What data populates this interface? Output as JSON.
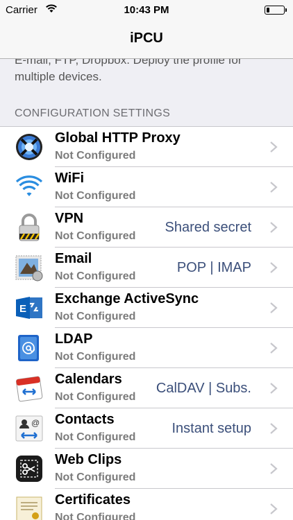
{
  "status_bar": {
    "carrier": "Carrier",
    "time": "10:43 PM"
  },
  "nav": {
    "title": "iPCU"
  },
  "description": "E-mail, FTP, Dropbox. Deploy the profile for multiple devices.",
  "section": {
    "header": "CONFIGURATION SETTINGS"
  },
  "items": [
    {
      "name": "Global HTTP Proxy",
      "status": "Not Configured",
      "detail": "",
      "icon": "proxy-globe-icon"
    },
    {
      "name": "WiFi",
      "status": "Not Configured",
      "detail": "",
      "icon": "wifi-icon"
    },
    {
      "name": "VPN",
      "status": "Not Configured",
      "detail": "Shared secret",
      "icon": "lock-icon"
    },
    {
      "name": "Email",
      "status": "Not Configured",
      "detail": "POP | IMAP",
      "icon": "mail-stamp-icon"
    },
    {
      "name": "Exchange ActiveSync",
      "status": "Not Configured",
      "detail": "",
      "icon": "exchange-icon"
    },
    {
      "name": "LDAP",
      "status": "Not Configured",
      "detail": "",
      "icon": "ldap-at-icon"
    },
    {
      "name": "Calendars",
      "status": "Not Configured",
      "detail": "CalDAV | Subs.",
      "icon": "calendar-icon"
    },
    {
      "name": "Contacts",
      "status": "Not Configured",
      "detail": "Instant setup",
      "icon": "contacts-icon"
    },
    {
      "name": "Web Clips",
      "status": "Not Configured",
      "detail": "",
      "icon": "web-clip-scissors-icon"
    },
    {
      "name": "Certificates",
      "status": "Not Configured",
      "detail": "",
      "icon": "certificate-icon"
    }
  ],
  "colors": {
    "detail_text": "#3b4f7a",
    "nav_background": "#f7f7f7",
    "page_background": "#efeff4"
  }
}
